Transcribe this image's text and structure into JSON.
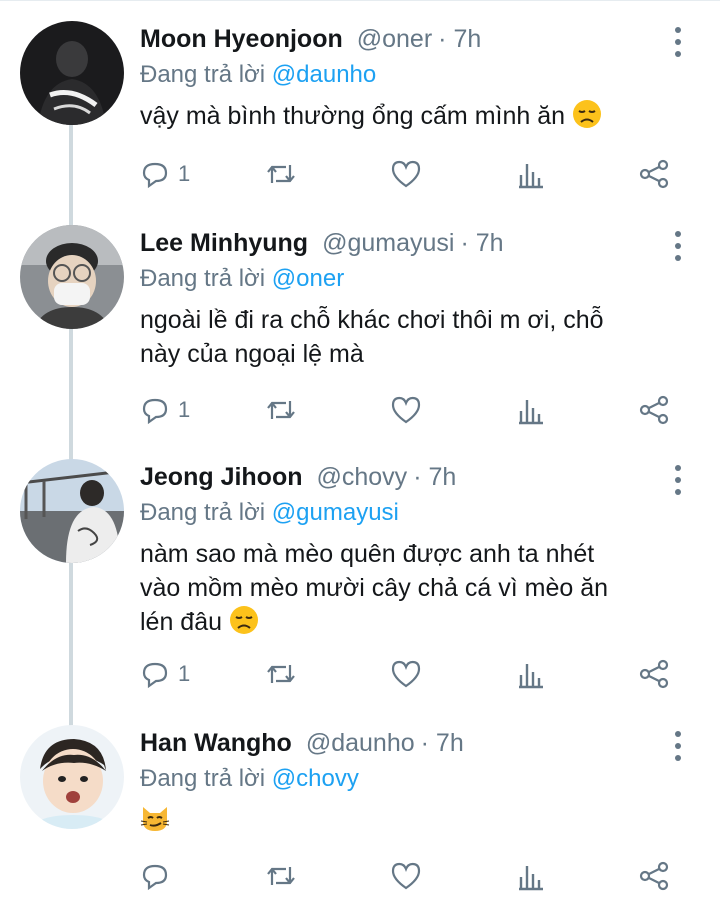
{
  "reply_prefix": "Đang trả lời",
  "colors": {
    "mention": "#1da1f2",
    "muted": "#657786",
    "thread_line": "#cfd9de"
  },
  "tweets": [
    {
      "name": "Moon Hyeonjoon",
      "handle": "@oner",
      "time": "· 7h",
      "reply_to": "@daunho",
      "lines": [
        "vậy mà bình thường ổng cấm mình ăn"
      ],
      "emoji": "disappointed-face",
      "reply_count": "1",
      "icons": [
        "reply-icon",
        "retweet-icon",
        "like-icon",
        "analytics-icon",
        "share-icon"
      ]
    },
    {
      "name": "Lee Minhyung",
      "handle": "@gumayusi",
      "time": "· 7h",
      "reply_to": "@oner",
      "lines": [
        "ngoài lề đi ra chỗ khác chơi thôi m ơi, chỗ",
        "này của ngoại lệ mà"
      ],
      "emoji": "",
      "reply_count": "1",
      "icons": [
        "reply-icon",
        "retweet-icon",
        "like-icon",
        "analytics-icon",
        "share-icon"
      ]
    },
    {
      "name": "Jeong Jihoon",
      "handle": "@chovy",
      "time": "· 7h",
      "reply_to": "@gumayusi",
      "lines": [
        "nàm sao mà mèo quên được anh ta nhét",
        "vào mồm mèo mười cây chả cá vì mèo ăn",
        "lén đâu"
      ],
      "emoji": "disappointed-face",
      "reply_count": "1",
      "icons": [
        "reply-icon",
        "retweet-icon",
        "like-icon",
        "analytics-icon",
        "share-icon"
      ]
    },
    {
      "name": "Han Wangho",
      "handle": "@daunho",
      "time": "· 7h",
      "reply_to": "@chovy",
      "lines": [],
      "emoji": "smirking-cat-face",
      "reply_count": "",
      "icons": [
        "reply-icon",
        "retweet-icon",
        "like-icon",
        "analytics-icon",
        "share-icon"
      ]
    }
  ]
}
